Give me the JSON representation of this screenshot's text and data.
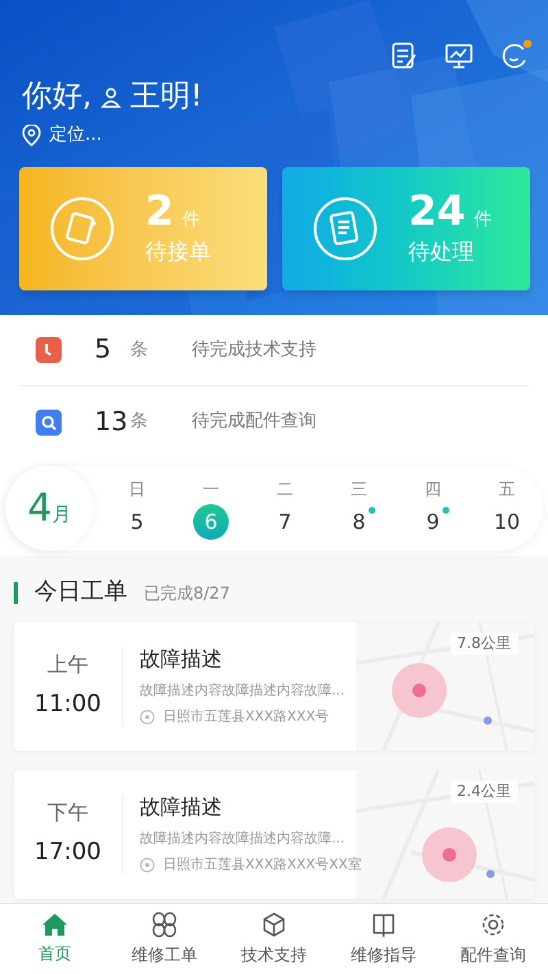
{
  "header": {
    "icons": [
      {
        "kind": "notes",
        "badge": false
      },
      {
        "kind": "monitor",
        "badge": false
      },
      {
        "kind": "message",
        "badge": true
      }
    ],
    "greeting": "你好,",
    "user": "王明!",
    "location": "定位..."
  },
  "summary_cards": [
    {
      "kind": "accept",
      "count": "2",
      "unit": "件",
      "label": "待接单"
    },
    {
      "kind": "process",
      "count": "24",
      "unit": "件",
      "label": "待处理"
    }
  ],
  "pending": [
    {
      "kind": "support",
      "count": "5",
      "unit": "条",
      "label": "待完成技术支持"
    },
    {
      "kind": "parts",
      "count": "13",
      "unit": "条",
      "label": "待完成配件查询"
    }
  ],
  "calendar": {
    "month": "4",
    "month_unit": "月",
    "days": [
      {
        "weekday": "日",
        "date": "5",
        "selected": false,
        "has_event": false
      },
      {
        "weekday": "一",
        "date": "6",
        "selected": true,
        "has_event": false
      },
      {
        "weekday": "二",
        "date": "7",
        "selected": false,
        "has_event": false
      },
      {
        "weekday": "三",
        "date": "8",
        "selected": false,
        "has_event": true
      },
      {
        "weekday": "四",
        "date": "9",
        "selected": false,
        "has_event": true
      },
      {
        "weekday": "五",
        "date": "10",
        "selected": false,
        "has_event": false
      }
    ]
  },
  "orders_section": {
    "title": "今日工单",
    "progress": "已完成8/27"
  },
  "orders": [
    {
      "period": "上午",
      "time": "11:00",
      "title": "故障描述",
      "description": "故障描述内容故障描述内容故障...",
      "address": "日照市五莲县XXX路XXX号",
      "distance": "7.8公里"
    },
    {
      "period": "下午",
      "time": "17:00",
      "title": "故障描述",
      "description": "故障描述内容故障描述内容故障...",
      "address": "日照市五莲县XXX路XXX号XX室",
      "distance": "2.4公里"
    }
  ],
  "tabs": [
    {
      "kind": "home",
      "label": "首页",
      "selected": true
    },
    {
      "kind": "orders",
      "label": "维修工单",
      "selected": false
    },
    {
      "kind": "support",
      "label": "技术支持",
      "selected": false
    },
    {
      "kind": "guide",
      "label": "维修指导",
      "selected": false
    },
    {
      "kind": "parts",
      "label": "配件查询",
      "selected": false
    }
  ]
}
